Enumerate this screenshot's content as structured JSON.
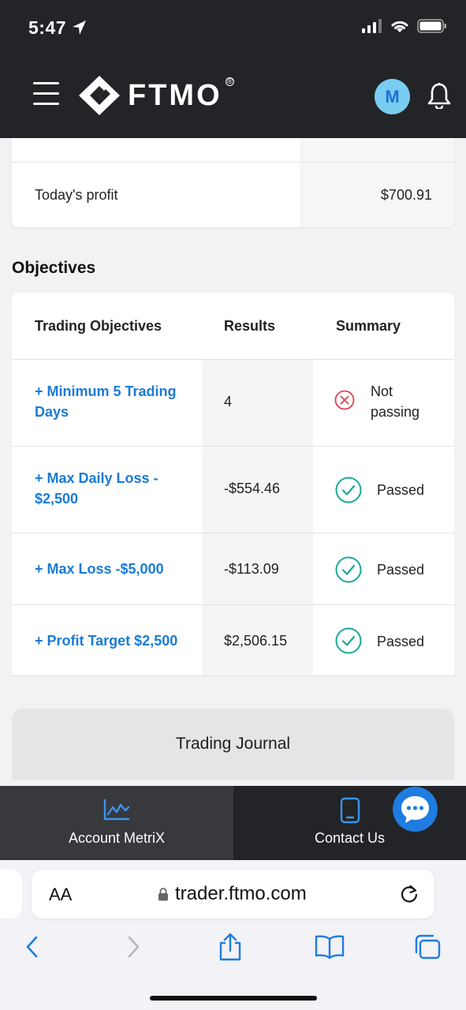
{
  "status_bar": {
    "time": "5:47"
  },
  "header": {
    "logo_text": "FTMO",
    "logo_reg": "®",
    "avatar_initial": "M"
  },
  "summary": {
    "profit_label": "Today's profit",
    "profit_value": "$700.91"
  },
  "objectives": {
    "title": "Objectives",
    "columns": [
      "Trading Objectives",
      "Results",
      "Summary"
    ],
    "rows": [
      {
        "objective_line1": "+ Minimum 5 Trading",
        "objective_line2": "Days",
        "result": "4",
        "summary_line1": "Not",
        "summary_line2": "passing",
        "status": "fail"
      },
      {
        "objective_line1": "+ Max Daily Loss -",
        "objective_line2": "$2,500",
        "result": "-$554.46",
        "summary": "Passed",
        "status": "pass"
      },
      {
        "objective_line1": "+ Max Loss -$5,000",
        "result": "-$113.09",
        "summary": "Passed",
        "status": "pass"
      },
      {
        "objective_line1": "+ Profit Target $2,500",
        "result": "$2,506.15",
        "summary": "Passed",
        "status": "pass"
      }
    ]
  },
  "journal_button": "Trading Journal",
  "bottom_nav": {
    "metrix_label": "Account MetriX",
    "contact_label": "Contact Us"
  },
  "browser": {
    "aa_label": "AA",
    "url": "trader.ftmo.com"
  },
  "colors": {
    "header_bg": "#232427",
    "link_blue": "#1b7bd6",
    "pass_teal": "#1aa89a",
    "fail_red": "#e0424f",
    "avatar_bg": "#79cdf1"
  },
  "icons": [
    "location-arrow-icon",
    "signal-icon",
    "wifi-icon",
    "battery-icon",
    "hamburger-menu-icon",
    "ftmo-logo-icon",
    "bell-icon",
    "fail-circle-x-icon",
    "pass-check-icon",
    "chart-line-icon",
    "phone-icon",
    "chat-bubble-icon",
    "lock-icon",
    "reload-icon",
    "back-icon",
    "forward-icon",
    "share-icon",
    "bookmarks-icon",
    "tabs-icon"
  ]
}
